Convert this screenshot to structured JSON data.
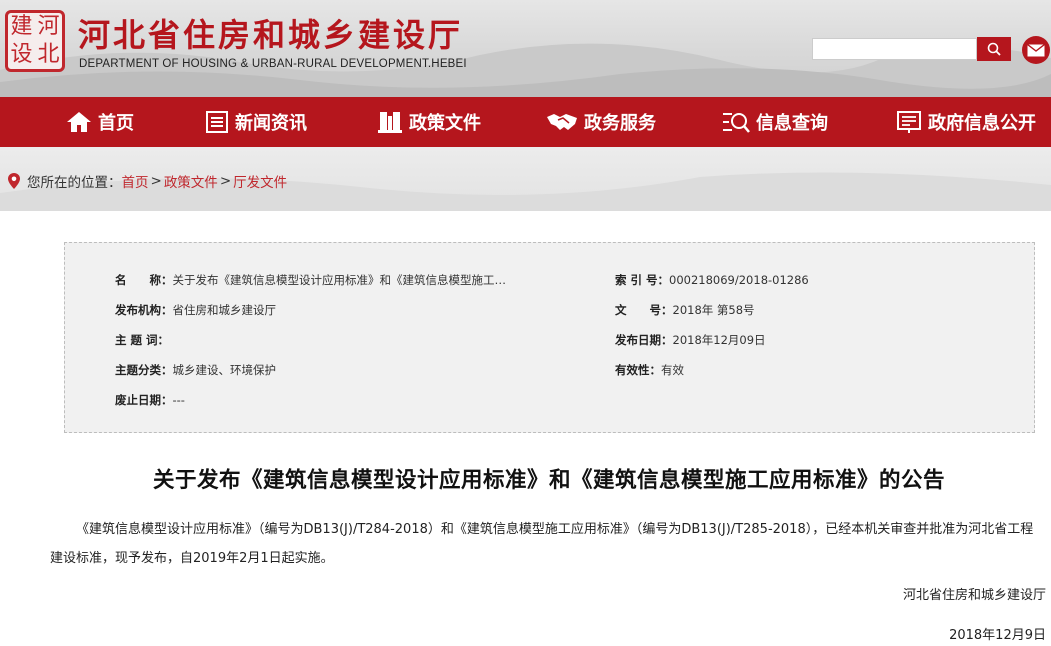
{
  "header": {
    "logo_chars": [
      "建",
      "河",
      "设",
      "北"
    ],
    "title": "河北省住房和城乡建设厅",
    "subtitle": "DEPARTMENT OF HOUSING & URBAN-RURAL DEVELOPMENT.HEBEI",
    "search_placeholder": "",
    "search_icon": "search-icon",
    "mail_icon": "mail-icon"
  },
  "nav": {
    "items": [
      {
        "label": "首页",
        "icon": "home-icon"
      },
      {
        "label": "新闻资讯",
        "icon": "news-icon"
      },
      {
        "label": "政策文件",
        "icon": "book-icon"
      },
      {
        "label": "政务服务",
        "icon": "handshake-icon"
      },
      {
        "label": "信息查询",
        "icon": "query-icon"
      },
      {
        "label": "政府信息公开",
        "icon": "open-info-icon"
      }
    ]
  },
  "breadcrumb": {
    "prefix": "您所在的位置：",
    "items": [
      "首页",
      "政策文件",
      "厅发文件"
    ],
    "separator": ">"
  },
  "info": {
    "name_label": "名　　称：",
    "name_value": "关于发布《建筑信息模型设计应用标准》和《建筑信息模型施工…",
    "index_label": "索 引 号：",
    "index_value": "000218069/2018-01286",
    "publisher_label": "发布机构：",
    "publisher_value": "省住房和城乡建设厅",
    "docno_label": "文　　号：",
    "docno_value": "2018年 第58号",
    "topic_label": "主 题 词：",
    "topic_value": "",
    "pubdate_label": "发布日期：",
    "pubdate_value": "2018年12月09日",
    "category_label": "主题分类：",
    "category_value": "城乡建设、环境保护",
    "validity_label": "有效性：",
    "validity_value": "有效",
    "expiry_label": "废止日期：",
    "expiry_value": "---"
  },
  "article": {
    "title": "关于发布《建筑信息模型设计应用标准》和《建筑信息模型施工应用标准》的公告",
    "body": "《建筑信息模型设计应用标准》（编号为DB13(J)/T284-2018）和《建筑信息模型施工应用标准》（编号为DB13(J)/T285-2018），已经本机关审查并批准为河北省工程建设标准，现予发布，自2019年2月1日起实施。",
    "signature": "河北省住房和城乡建设厅",
    "date": "2018年12月9日"
  },
  "colors": {
    "brand_red": "#b5161d",
    "link_red": "#c0272d"
  }
}
